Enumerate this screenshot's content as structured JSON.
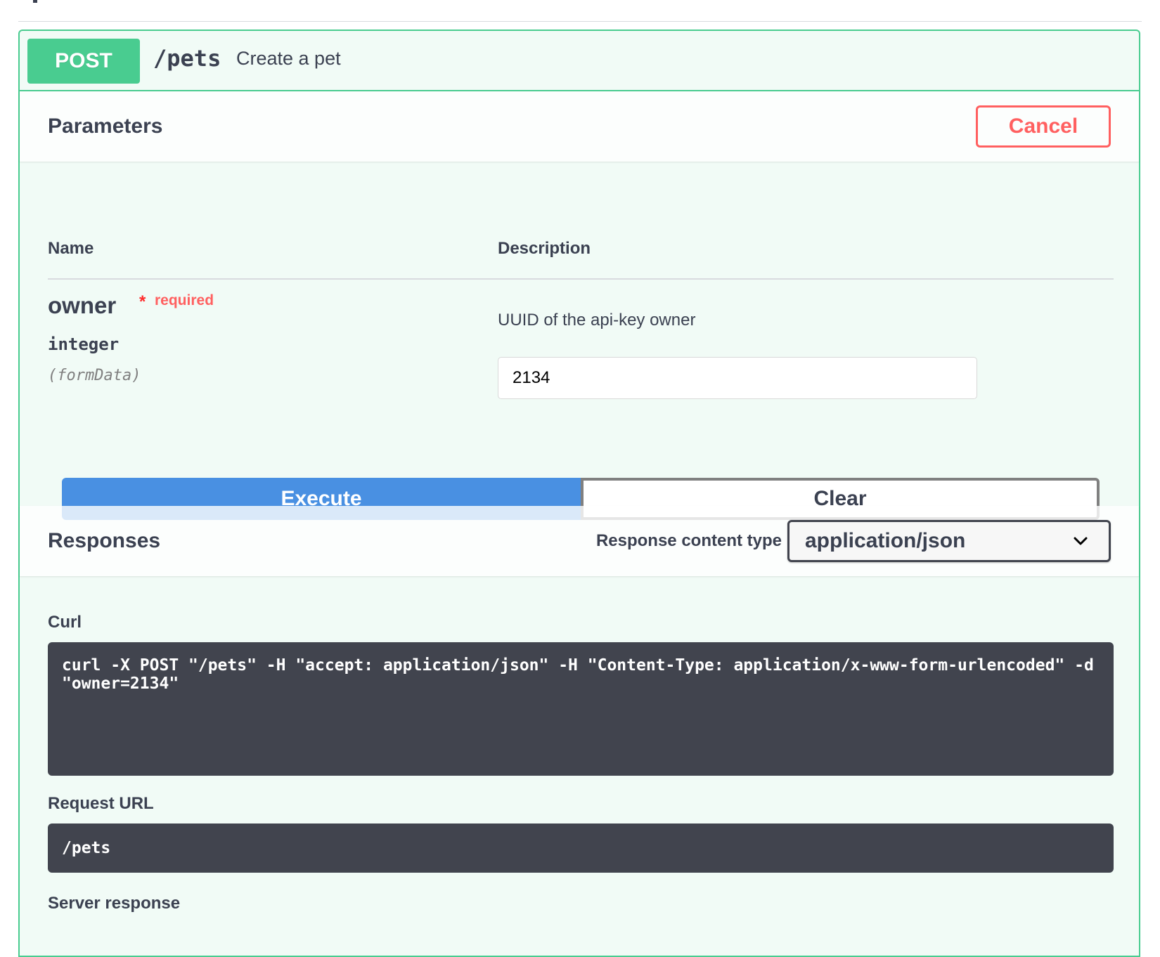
{
  "operation": {
    "method": "POST",
    "path": "/pets",
    "summary": "Create a pet"
  },
  "parameters": {
    "title": "Parameters",
    "cancel_label": "Cancel",
    "columns": {
      "name": "Name",
      "description": "Description"
    },
    "items": [
      {
        "name": "owner",
        "required_star": "*",
        "required_label": "required",
        "type": "integer",
        "in": "(formData)",
        "description": "UUID of the api-key owner",
        "value": "2134"
      }
    ]
  },
  "actions": {
    "execute_label": "Execute",
    "clear_label": "Clear"
  },
  "responses": {
    "title": "Responses",
    "content_type_label": "Response content type",
    "content_type_value": "application/json"
  },
  "curl": {
    "label": "Curl",
    "command": "curl -X POST \"/pets\" -H \"accept: application/json\" -H \"Content-Type: application/x-www-form-urlencoded\" -d \"owner=2134\""
  },
  "request_url": {
    "label": "Request URL",
    "value": "/pets"
  },
  "server_response": {
    "label": "Server response"
  },
  "colors": {
    "post_green": "#49cc90",
    "cancel_red": "#ff6060",
    "execute_blue": "#4990e2",
    "code_bg": "#41444e"
  }
}
